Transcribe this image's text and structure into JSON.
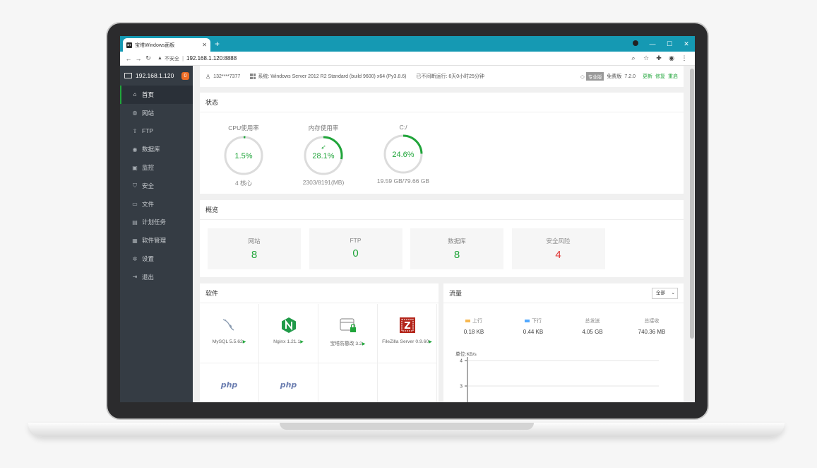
{
  "browser": {
    "tab_favicon": "BT",
    "tab_title": "宝塔Windows面板",
    "url_warning": "不安全",
    "url": "192.168.1.120:8888"
  },
  "sidebar": {
    "server_ip": "192.168.1.120",
    "badge_count": "0",
    "items": [
      {
        "label": "首页",
        "icon": "home-icon",
        "glyph": "⌂"
      },
      {
        "label": "网站",
        "icon": "globe-icon",
        "glyph": "◍"
      },
      {
        "label": "FTP",
        "icon": "ftp-icon",
        "glyph": "⇪"
      },
      {
        "label": "数据库",
        "icon": "database-icon",
        "glyph": "◉"
      },
      {
        "label": "监控",
        "icon": "monitor-icon",
        "glyph": "▣"
      },
      {
        "label": "安全",
        "icon": "shield-icon",
        "glyph": "⛉"
      },
      {
        "label": "文件",
        "icon": "folder-icon",
        "glyph": "▭"
      },
      {
        "label": "计划任务",
        "icon": "calendar-icon",
        "glyph": "▤"
      },
      {
        "label": "软件管理",
        "icon": "apps-icon",
        "glyph": "▦"
      },
      {
        "label": "设置",
        "icon": "gear-icon",
        "glyph": "✲"
      },
      {
        "label": "退出",
        "icon": "logout-icon",
        "glyph": "⇥"
      }
    ]
  },
  "topinfo": {
    "user": "132****7377",
    "system": "系统:",
    "os": "Windows Server 2012 R2 Standard (build 9600) x64 (Py3.8.6)",
    "uptime": "已不间断运行: 6天0小时25分钟",
    "pro_label": "专业版",
    "free_label": "免费版",
    "version": "7.2.0",
    "update": "更新",
    "repair": "修复",
    "restart": "重启"
  },
  "status": {
    "title": "状态",
    "gauges": [
      {
        "label": "CPU使用率",
        "value": "1.5%",
        "percent": 1.5,
        "sub": "4 核心",
        "rocket": false
      },
      {
        "label": "内存使用率",
        "value": "28.1%",
        "percent": 28.1,
        "sub": "2303/8191(MB)",
        "rocket": true
      },
      {
        "label": "C:/",
        "value": "24.6%",
        "percent": 24.6,
        "sub": "19.59 GB/79.66 GB",
        "rocket": false
      }
    ]
  },
  "overview": {
    "title": "概览",
    "items": [
      {
        "label": "网站",
        "value": "8"
      },
      {
        "label": "FTP",
        "value": "0"
      },
      {
        "label": "数据库",
        "value": "8"
      },
      {
        "label": "安全风险",
        "value": "4"
      }
    ]
  },
  "software": {
    "title": "软件",
    "items": [
      {
        "name": "MySQL 5.5.62",
        "icon": "mysql-icon"
      },
      {
        "name": "Nginx 1.21.1",
        "icon": "nginx-icon"
      },
      {
        "name": "宝塔防篡改 3.2",
        "icon": "tamper-proof-icon"
      },
      {
        "name": "FileZilla Server 0.9.60",
        "icon": "filezilla-icon"
      },
      {
        "name": "",
        "icon": "php-icon",
        "logo": "php"
      },
      {
        "name": "",
        "icon": "php-icon",
        "logo": "php"
      }
    ]
  },
  "traffic": {
    "title": "流量",
    "select_value": "全部",
    "upload_label": "上行",
    "upload_value": "0.18 KB",
    "download_label": "下行",
    "download_value": "0.44 KB",
    "total_sent_label": "总发送",
    "total_sent_value": "4.05 GB",
    "total_recv_label": "总接收",
    "total_recv_value": "740.36 MB",
    "unit": "单位:KB/s",
    "y_ticks": [
      "4",
      "3"
    ],
    "upload_color": "#f7b851",
    "download_color": "#52a9ff"
  },
  "colors": {
    "accent": "#20a53a",
    "danger": "#e03636",
    "sidebar_bg": "#353c44",
    "tab_bar": "#1599b3"
  }
}
